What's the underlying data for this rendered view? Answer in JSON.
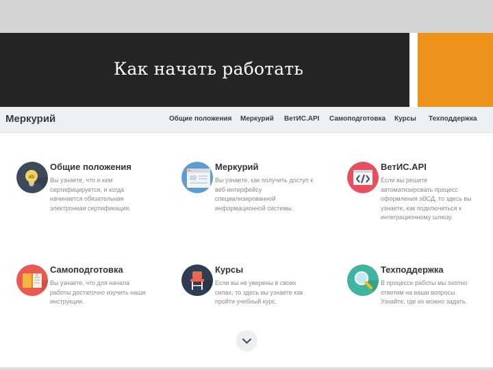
{
  "slide": {
    "title": "Как начать работать"
  },
  "site": {
    "brand": "Меркурий",
    "nav": [
      {
        "label": "Общие положения"
      },
      {
        "label": "Меркурий"
      },
      {
        "label": "ВетИС.API"
      },
      {
        "label": "Самоподготовка"
      },
      {
        "label": "Курсы"
      },
      {
        "label": "Техподдержка"
      }
    ]
  },
  "cards": [
    {
      "title": "Общие положения",
      "desc": "Вы узнаете, что и кем сертифицируется, и когда начинается обязательная электронная сертификация.",
      "icon": "lightbulb-icon",
      "color": "#3c4a5c"
    },
    {
      "title": "Меркурий",
      "desc": "Вы узнаете, как получить доступ к веб-интерфейсу специализированной информационной системы.",
      "icon": "browser-window-icon",
      "color": "#5d9ccd"
    },
    {
      "title": "ВетИС.API",
      "desc": "Если вы решите автоматизировать процесс оформления эВСД, то здесь вы узнаете, как подключиться к интеграционному шлюзу.",
      "icon": "code-icon",
      "color": "#e4505e"
    },
    {
      "title": "Самоподготовка",
      "desc": "Вы узнаете, что для начала работы достаточно изучить наши инструкции.",
      "icon": "book-icon",
      "color": "#ea5a4f"
    },
    {
      "title": "Курсы",
      "desc": "Если вы не уверены в своих силах, то здесь вы узнаете как пройти учебный курс.",
      "icon": "chair-icon",
      "color": "#2e3d52"
    },
    {
      "title": "Техподдержка",
      "desc": "В процессе работы мы охотно ответим на ваши вопросы. Узнайте, где их можно задать.",
      "icon": "magnifier-icon",
      "color": "#3fb49e"
    }
  ],
  "scroll": {
    "icon": "chevron-down-icon"
  }
}
